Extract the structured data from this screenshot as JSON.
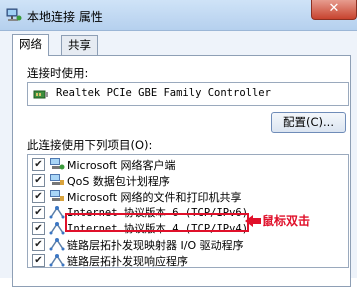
{
  "window": {
    "title": "本地连接 属性",
    "close_label": "✕"
  },
  "tabs": [
    {
      "label": "网络"
    },
    {
      "label": "共享"
    }
  ],
  "connect_using": {
    "label": "连接时使用:",
    "adapter": "Realtek PCIe GBE Family Controller"
  },
  "configure_button": "配置(C)...",
  "items_label": "此连接使用下列项目(O):",
  "items": [
    {
      "label": "Microsoft 网络客户端",
      "checked": true,
      "icon": "network-client-icon"
    },
    {
      "label": "QoS 数据包计划程序",
      "checked": true,
      "icon": "service-icon"
    },
    {
      "label": "Microsoft 网络的文件和打印机共享",
      "checked": true,
      "icon": "service-icon"
    },
    {
      "label": "Internet 协议版本 6 (TCP/IPv6)",
      "checked": true,
      "icon": "protocol-icon"
    },
    {
      "label": "Internet 协议版本 4 (TCP/IPv4)",
      "checked": true,
      "icon": "protocol-icon"
    },
    {
      "label": "链路层拓扑发现映射器 I/O 驱动程序",
      "checked": true,
      "icon": "protocol-icon"
    },
    {
      "label": "链路层拓扑发现响应程序",
      "checked": true,
      "icon": "protocol-icon"
    }
  ],
  "annotation": {
    "text": "鼠标双击",
    "color": "#e0102a"
  },
  "check_mark": "✔"
}
